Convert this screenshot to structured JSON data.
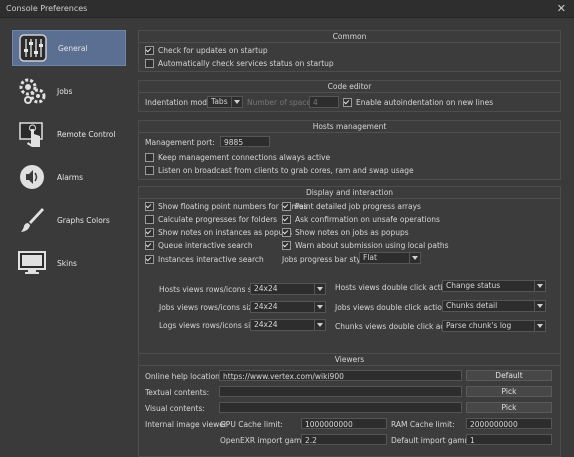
{
  "window": {
    "title": "Console Preferences"
  },
  "sidebar": {
    "items": [
      {
        "label": "General",
        "icon": "sliders-icon",
        "active": true
      },
      {
        "label": "Jobs",
        "icon": "gears-icon"
      },
      {
        "label": "Remote Control",
        "icon": "touch-hand-icon"
      },
      {
        "label": "Alarms",
        "icon": "speaker-icon"
      },
      {
        "label": "Graphs Colors",
        "icon": "paint-brush-icon"
      },
      {
        "label": "Skins",
        "icon": "monitor-icon"
      }
    ]
  },
  "common": {
    "title": "Common",
    "check_updates": "Check for updates on startup",
    "auto_check_services": "Automatically check services status on startup"
  },
  "code_editor": {
    "title": "Code editor",
    "indentation_mode_label": "Indentation mode:",
    "indentation_mode_value": "Tabs",
    "spaces_label": "Number of spaces:",
    "spaces_value": "4",
    "auto_indent": "Enable autoindentation on new lines"
  },
  "hosts": {
    "title": "Hosts management",
    "port_label": "Management port:",
    "port_value": "9885",
    "keep_connections": "Keep management connections always active",
    "listen_broadcast": "Listen on broadcast from clients to grab cores, ram and swap usage"
  },
  "display": {
    "title": "Display and interaction",
    "left": [
      {
        "label": "Show floating point numbers for frames",
        "checked": true
      },
      {
        "label": "Calculate progresses for folders",
        "checked": false
      },
      {
        "label": "Show notes on instances as popups",
        "checked": true
      },
      {
        "label": "Queue interactive search",
        "checked": true
      },
      {
        "label": "Instances interactive search",
        "checked": true
      }
    ],
    "right": [
      {
        "label": "Paint detailed job progress arrays",
        "checked": true
      },
      {
        "label": "Ask confirmation on unsafe operations",
        "checked": true
      },
      {
        "label": "Show notes on jobs as popups",
        "checked": true
      },
      {
        "label": "Warn about submission using local paths",
        "checked": true
      }
    ],
    "progress_style_label": "Jobs progress bar style:",
    "progress_style_value": "Flat",
    "hosts_rows_label": "Hosts views rows/icons size:",
    "hosts_rows_value": "24x24",
    "jobs_rows_label": "Jobs views rows/icons size:",
    "jobs_rows_value": "24x24",
    "logs_rows_label": "Logs views rows/icons size:",
    "logs_rows_value": "24x24",
    "hosts_dbl_label": "Hosts views double click action:",
    "hosts_dbl_value": "Change status",
    "jobs_dbl_label": "Jobs views double click action:",
    "jobs_dbl_value": "Chunks detail",
    "chunks_dbl_label": "Chunks views double click action:",
    "chunks_dbl_value": "Parse chunk's log"
  },
  "viewers": {
    "title": "Viewers",
    "help_label": "Online help location:",
    "help_value": "https://www.vertex.com/wiki900",
    "default_button": "Default",
    "textual_label": "Textual contents:",
    "visual_label": "Visual contents:",
    "pick_button": "Pick",
    "internal_label": "Internal image viewer",
    "gpu_label": "GPU Cache limit:",
    "gpu_value": "1000000000",
    "ram_label": "RAM Cache limit:",
    "ram_value": "2000000000",
    "openexr_label": "OpenEXR import gamma:",
    "openexr_value": "2.2",
    "default_gamma_label": "Default import gamma:",
    "default_gamma_value": "1"
  }
}
